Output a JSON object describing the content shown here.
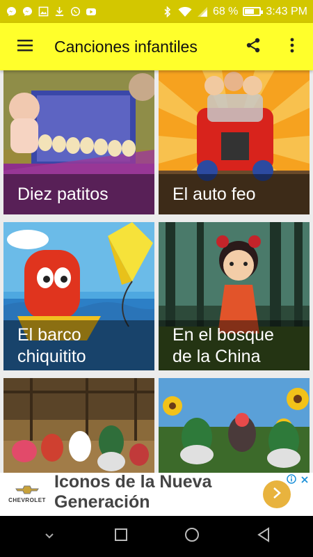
{
  "status_bar": {
    "battery_percent_text": "68 %",
    "battery_level": 0.68,
    "time": "3:43 PM",
    "notification_icons": [
      "messenger-icon",
      "messenger-icon",
      "image-icon",
      "download-icon",
      "whatsapp-icon",
      "youtube-icon"
    ],
    "system_icons": [
      "bluetooth-icon",
      "wifi-icon",
      "signal-icon",
      "battery-icon"
    ]
  },
  "toolbar": {
    "title": "Canciones infantiles",
    "menu_icon": "hamburger-menu-icon",
    "share_icon": "share-icon",
    "more_icon": "more-vert-icon"
  },
  "cards": [
    {
      "id": "diez-patitos",
      "title": "Diez patitos"
    },
    {
      "id": "el-auto-feo",
      "title": "El auto feo"
    },
    {
      "id": "el-barco-chiquitito",
      "title": "El barco\nchiquitito"
    },
    {
      "id": "en-el-bosque",
      "title": "En el bosque\nde la China"
    },
    {
      "id": "card-5",
      "title": ""
    },
    {
      "id": "card-6",
      "title": ""
    }
  ],
  "ad": {
    "brand": "CHEVROLET",
    "text": "Iconos de la Nueva Generación",
    "cta_icon": "chevron-right-icon",
    "choices_icons": [
      "info-icon",
      "close-icon"
    ]
  },
  "nav_bar": {
    "buttons": [
      "hide-keyboard-icon",
      "recents-icon",
      "home-icon",
      "back-icon"
    ]
  },
  "colors": {
    "status_bar": "#d3c700",
    "toolbar": "#ffff2b",
    "ad_cta": "#e8b33e"
  }
}
